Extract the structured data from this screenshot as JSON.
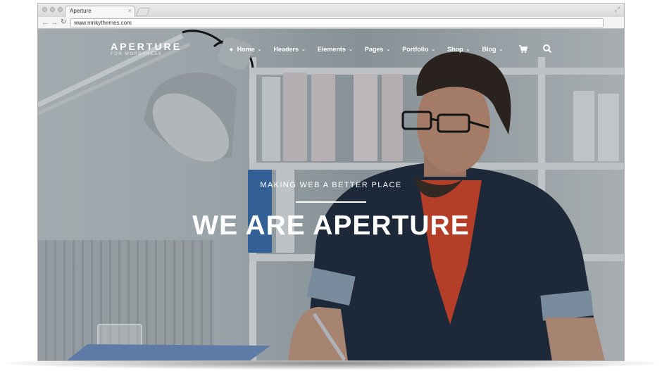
{
  "browser": {
    "tab_title": "Aperture",
    "tab_close_icon": "close-icon",
    "url": "www.mnkythemes.com",
    "back_icon": "back-arrow-icon",
    "forward_icon": "forward-arrow-icon",
    "reload_icon": "reload-icon"
  },
  "site": {
    "logo": {
      "name": "APERTURE",
      "tagline": "FOR WORDPRESS"
    },
    "nav": [
      {
        "label": "Home"
      },
      {
        "label": "Headers"
      },
      {
        "label": "Elements"
      },
      {
        "label": "Pages"
      },
      {
        "label": "Portfolio"
      },
      {
        "label": "Shop"
      },
      {
        "label": "Blog"
      }
    ],
    "icons": {
      "cart": "cart-icon",
      "search": "search-icon"
    }
  },
  "hero": {
    "subtitle": "MAKING WEB A BETTER PLACE",
    "title": "WE ARE APERTURE"
  },
  "colors": {
    "accent": "#ffffff",
    "shirt": "#d8452a",
    "jacket": "#1f2a3d"
  }
}
